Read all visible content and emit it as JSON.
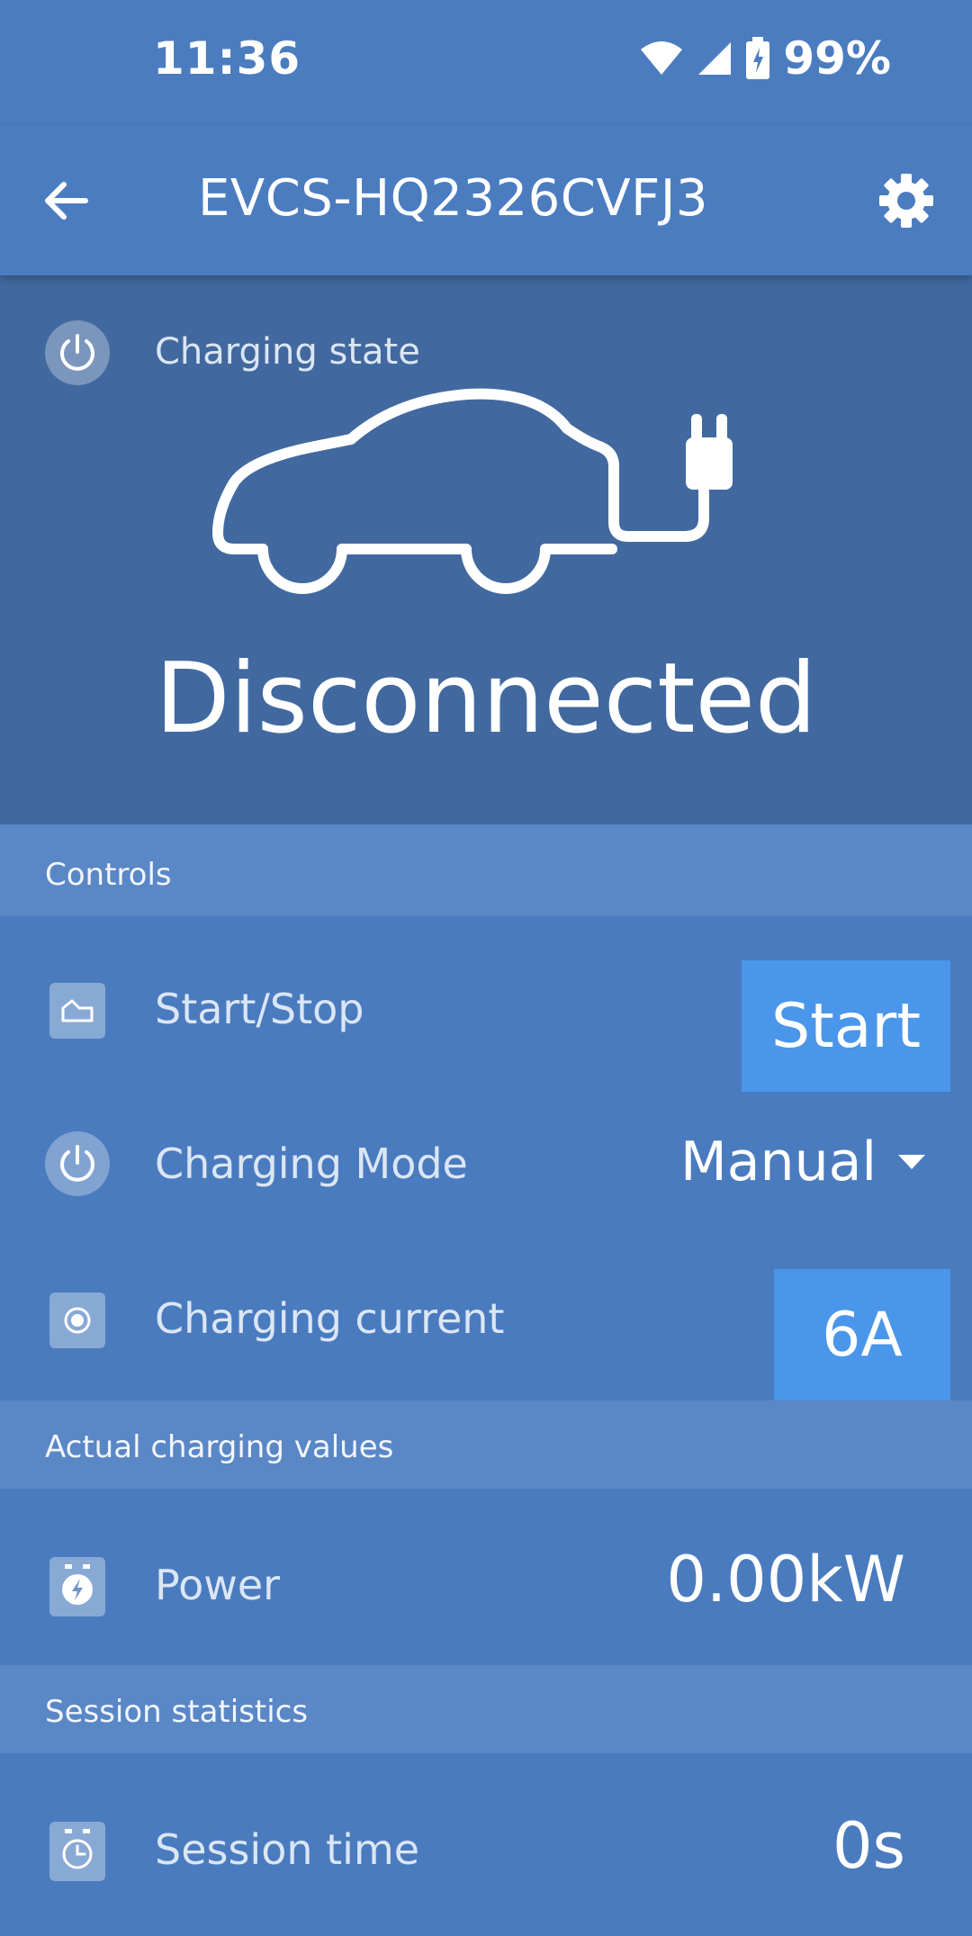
{
  "status": {
    "time": "11:36",
    "battery": "99%"
  },
  "appbar": {
    "title": "EVCS-HQ2326CVFJ3",
    "back_icon": "arrow-left-icon",
    "settings_icon": "gear-icon"
  },
  "hero": {
    "label": "Charging state",
    "state": "Disconnected",
    "icon": "power-icon",
    "art": "car-plug-icon"
  },
  "sections": {
    "controls": "Controls",
    "actual": "Actual charging values",
    "session": "Session statistics"
  },
  "controls": {
    "start_stop": {
      "label": "Start/Stop",
      "button": "Start"
    },
    "mode": {
      "label": "Charging Mode",
      "value": "Manual"
    },
    "current": {
      "label": "Charging current",
      "value": "6A"
    }
  },
  "actual": {
    "power": {
      "label": "Power",
      "value": "0.00kW"
    }
  },
  "session": {
    "time": {
      "label": "Session time",
      "value": "0s"
    }
  },
  "colors": {
    "primary": "#4b7cc0",
    "hero": "#41699f",
    "section": "#5a87c6",
    "accent": "#4a96ea"
  }
}
